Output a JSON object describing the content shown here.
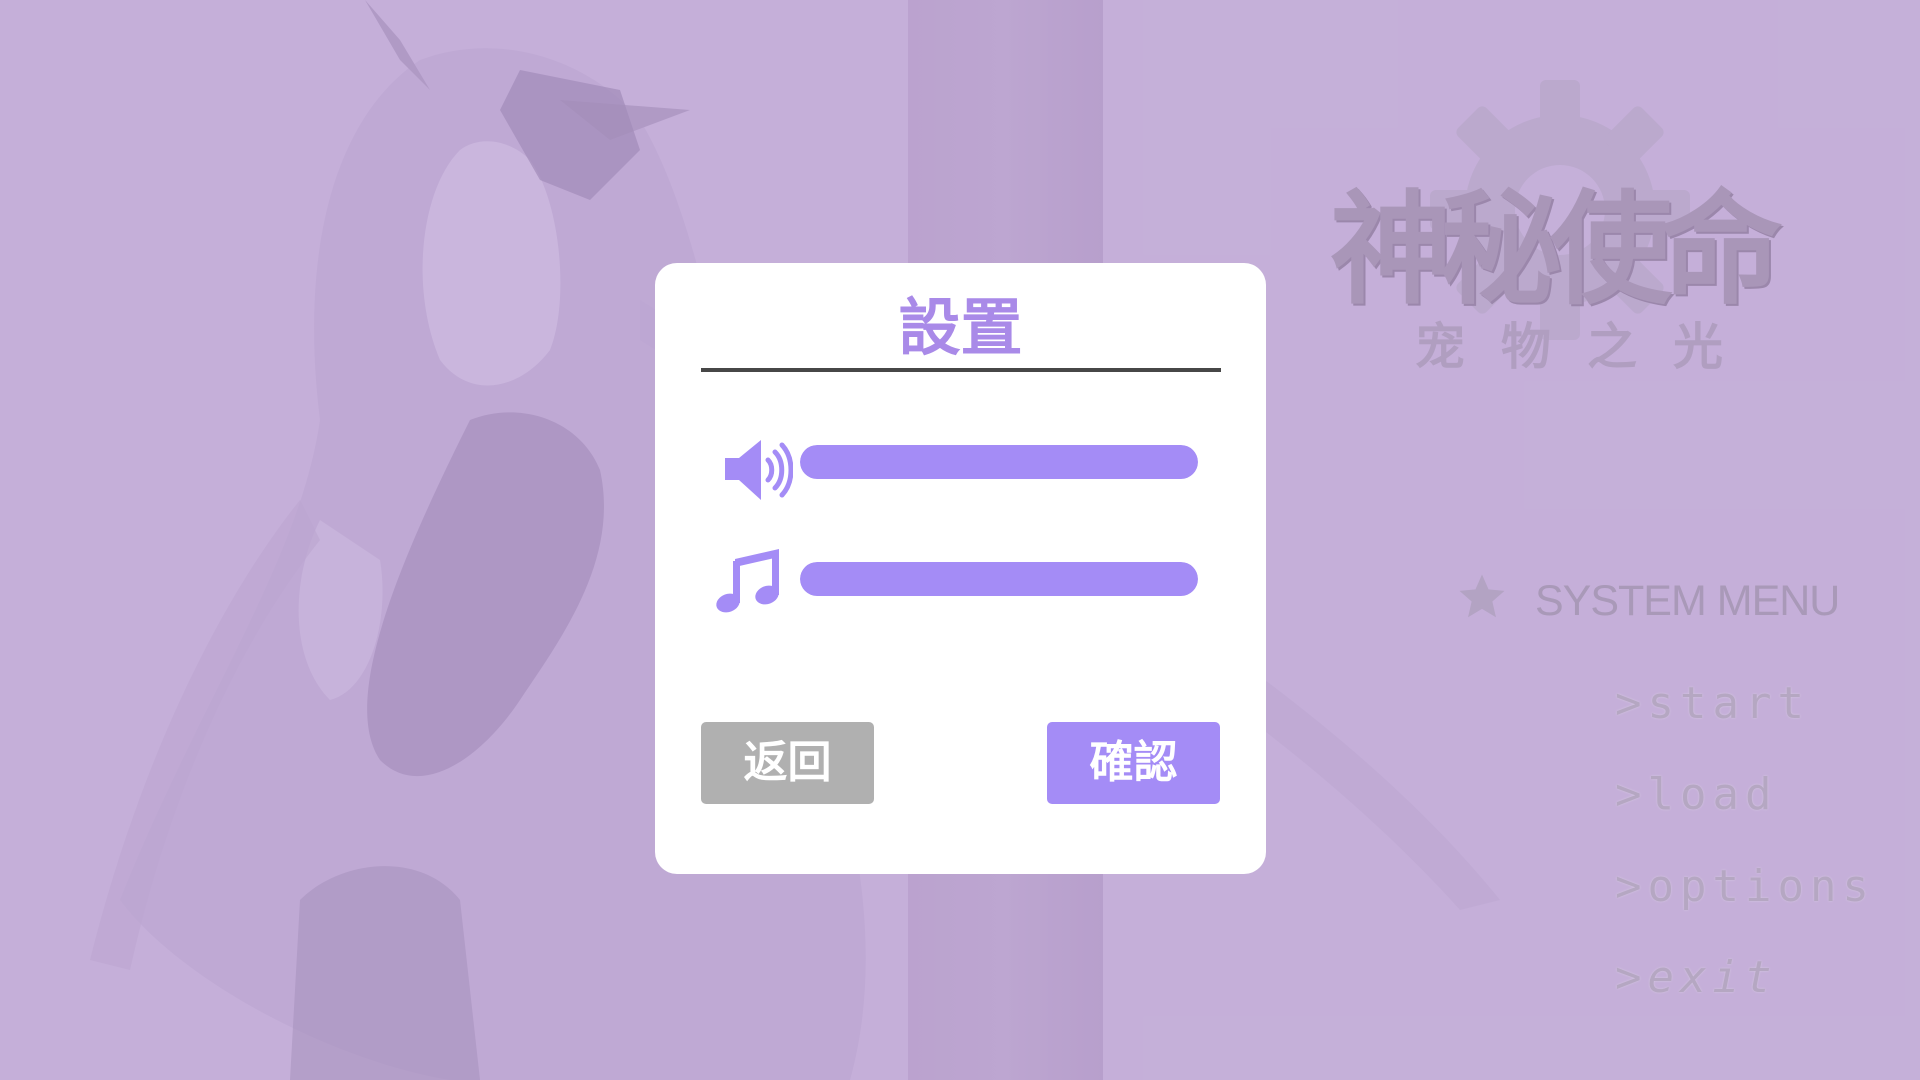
{
  "logo": {
    "title": "神秘使命",
    "subtitle": "宠物之光"
  },
  "system_menu": {
    "header": "SYSTEM MENU",
    "header_icon": "star-icon",
    "items": [
      {
        "label": ">start"
      },
      {
        "label": ">load"
      },
      {
        "label": ">options"
      },
      {
        "label": ">exit"
      }
    ]
  },
  "settings_dialog": {
    "title": "設置",
    "sliders": [
      {
        "icon": "speaker-icon",
        "level": 1.0
      },
      {
        "icon": "music-note-icon",
        "level": 1.0
      }
    ],
    "back_label": "返回",
    "confirm_label": "確認"
  },
  "colors": {
    "background": "#c5b0d9",
    "accent": "#a48cf6",
    "title_text": "#a98ae8",
    "back_button": "#b0b0b0",
    "dialog_bg": "#ffffff"
  }
}
